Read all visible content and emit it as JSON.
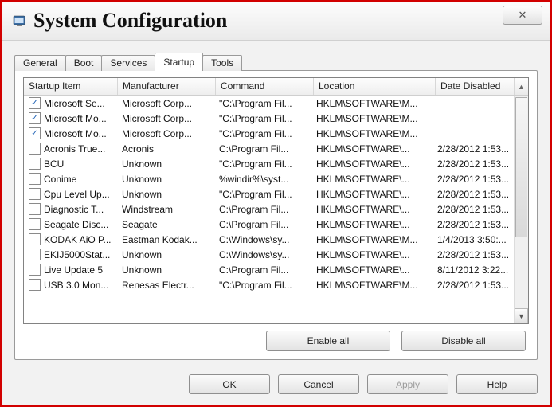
{
  "window": {
    "title": "System Configuration"
  },
  "tabs": [
    "General",
    "Boot",
    "Services",
    "Startup",
    "Tools"
  ],
  "active_tab_index": 3,
  "columns": [
    "Startup Item",
    "Manufacturer",
    "Command",
    "Location",
    "Date Disabled"
  ],
  "rows": [
    {
      "checked": true,
      "item": "Microsoft Se...",
      "mfr": "Microsoft Corp...",
      "cmd": "\"C:\\Program Fil...",
      "loc": "HKLM\\SOFTWARE\\M...",
      "date": ""
    },
    {
      "checked": true,
      "item": "Microsoft Mo...",
      "mfr": "Microsoft Corp...",
      "cmd": "\"C:\\Program Fil...",
      "loc": "HKLM\\SOFTWARE\\M...",
      "date": ""
    },
    {
      "checked": true,
      "item": "Microsoft Mo...",
      "mfr": "Microsoft Corp...",
      "cmd": "\"C:\\Program Fil...",
      "loc": "HKLM\\SOFTWARE\\M...",
      "date": ""
    },
    {
      "checked": false,
      "item": "Acronis True...",
      "mfr": "Acronis",
      "cmd": "C:\\Program Fil...",
      "loc": "HKLM\\SOFTWARE\\...",
      "date": "2/28/2012 1:53..."
    },
    {
      "checked": false,
      "item": "BCU",
      "mfr": "Unknown",
      "cmd": "\"C:\\Program Fil...",
      "loc": "HKLM\\SOFTWARE\\...",
      "date": "2/28/2012 1:53..."
    },
    {
      "checked": false,
      "item": "Conime",
      "mfr": "Unknown",
      "cmd": "%windir%\\syst...",
      "loc": "HKLM\\SOFTWARE\\...",
      "date": "2/28/2012 1:53..."
    },
    {
      "checked": false,
      "item": "Cpu Level Up...",
      "mfr": "Unknown",
      "cmd": "\"C:\\Program Fil...",
      "loc": "HKLM\\SOFTWARE\\...",
      "date": "2/28/2012 1:53..."
    },
    {
      "checked": false,
      "item": "Diagnostic T...",
      "mfr": "Windstream",
      "cmd": "C:\\Program Fil...",
      "loc": "HKLM\\SOFTWARE\\...",
      "date": "2/28/2012 1:53..."
    },
    {
      "checked": false,
      "item": "Seagate Disc...",
      "mfr": "Seagate",
      "cmd": "C:\\Program Fil...",
      "loc": "HKLM\\SOFTWARE\\...",
      "date": "2/28/2012 1:53..."
    },
    {
      "checked": false,
      "item": "KODAK AiO P...",
      "mfr": "Eastman Kodak...",
      "cmd": "C:\\Windows\\sy...",
      "loc": "HKLM\\SOFTWARE\\M...",
      "date": "1/4/2013 3:50:..."
    },
    {
      "checked": false,
      "item": "EKIJ5000Stat...",
      "mfr": "Unknown",
      "cmd": "C:\\Windows\\sy...",
      "loc": "HKLM\\SOFTWARE\\...",
      "date": "2/28/2012 1:53..."
    },
    {
      "checked": false,
      "item": "Live Update 5",
      "mfr": "Unknown",
      "cmd": "C:\\Program Fil...",
      "loc": "HKLM\\SOFTWARE\\...",
      "date": "8/11/2012 3:22..."
    },
    {
      "checked": false,
      "item": "USB 3.0 Mon...",
      "mfr": "Renesas Electr...",
      "cmd": "\"C:\\Program Fil...",
      "loc": "HKLM\\SOFTWARE\\M...",
      "date": "2/28/2012 1:53..."
    }
  ],
  "panel_buttons": {
    "enable_all": "Enable all",
    "disable_all": "Disable all"
  },
  "dialog_buttons": {
    "ok": "OK",
    "cancel": "Cancel",
    "apply": "Apply",
    "help": "Help"
  }
}
